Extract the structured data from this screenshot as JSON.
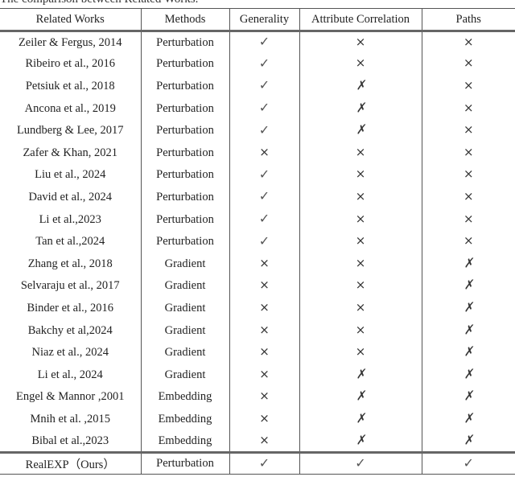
{
  "caption": "The comparison between Related Works.",
  "symbols": {
    "yes": "✓",
    "no": "×",
    "partial": "✗"
  },
  "table": {
    "headers": [
      "Related Works",
      "Methods",
      "Generality",
      "Attribute Correlation",
      "Paths"
    ],
    "rows": [
      {
        "work": "Zeiler & Fergus, 2014",
        "method": "Perturbation",
        "generality": "yes",
        "attribute_correlation": "no",
        "paths": "no"
      },
      {
        "work": "Ribeiro et al., 2016",
        "method": "Perturbation",
        "generality": "yes",
        "attribute_correlation": "no",
        "paths": "no"
      },
      {
        "work": "Petsiuk et al., 2018",
        "method": "Perturbation",
        "generality": "yes",
        "attribute_correlation": "partial",
        "paths": "no"
      },
      {
        "work": "Ancona et al., 2019",
        "method": "Perturbation",
        "generality": "yes",
        "attribute_correlation": "partial",
        "paths": "no"
      },
      {
        "work": "Lundberg & Lee, 2017",
        "method": "Perturbation",
        "generality": "yes",
        "attribute_correlation": "partial",
        "paths": "no"
      },
      {
        "work": "Zafer & Khan, 2021",
        "method": "Perturbation",
        "generality": "no",
        "attribute_correlation": "no",
        "paths": "no"
      },
      {
        "work": "Liu et al., 2024",
        "method": "Perturbation",
        "generality": "yes",
        "attribute_correlation": "no",
        "paths": "no"
      },
      {
        "work": "David et al., 2024",
        "method": "Perturbation",
        "generality": "yes",
        "attribute_correlation": "no",
        "paths": "no"
      },
      {
        "work": "Li et al.,2023",
        "method": "Perturbation",
        "generality": "yes",
        "attribute_correlation": "no",
        "paths": "no"
      },
      {
        "work": "Tan et al.,2024",
        "method": "Perturbation",
        "generality": "yes",
        "attribute_correlation": "no",
        "paths": "no"
      },
      {
        "work": "Zhang et al., 2018",
        "method": "Gradient",
        "generality": "no",
        "attribute_correlation": "no",
        "paths": "partial"
      },
      {
        "work": "Selvaraju et al., 2017",
        "method": "Gradient",
        "generality": "no",
        "attribute_correlation": "no",
        "paths": "partial"
      },
      {
        "work": "Binder et al., 2016",
        "method": "Gradient",
        "generality": "no",
        "attribute_correlation": "no",
        "paths": "partial"
      },
      {
        "work": "Bakchy et al,2024",
        "method": "Gradient",
        "generality": "no",
        "attribute_correlation": "no",
        "paths": "partial"
      },
      {
        "work": "Niaz et al., 2024",
        "method": "Gradient",
        "generality": "no",
        "attribute_correlation": "no",
        "paths": "partial"
      },
      {
        "work": "Li et al., 2024",
        "method": "Gradient",
        "generality": "no",
        "attribute_correlation": "partial",
        "paths": "partial"
      },
      {
        "work": "Engel & Mannor ,2001",
        "method": "Embedding",
        "generality": "no",
        "attribute_correlation": "partial",
        "paths": "partial"
      },
      {
        "work": "Mnih et al. ,2015",
        "method": "Embedding",
        "generality": "no",
        "attribute_correlation": "partial",
        "paths": "partial"
      },
      {
        "work": "Bibal et al.,2023",
        "method": "Embedding",
        "generality": "no",
        "attribute_correlation": "partial",
        "paths": "partial"
      }
    ],
    "footer_row": {
      "work": "RealEXP（Ours）",
      "method": "Perturbation",
      "generality": "yes",
      "attribute_correlation": "yes",
      "paths": "yes"
    }
  }
}
